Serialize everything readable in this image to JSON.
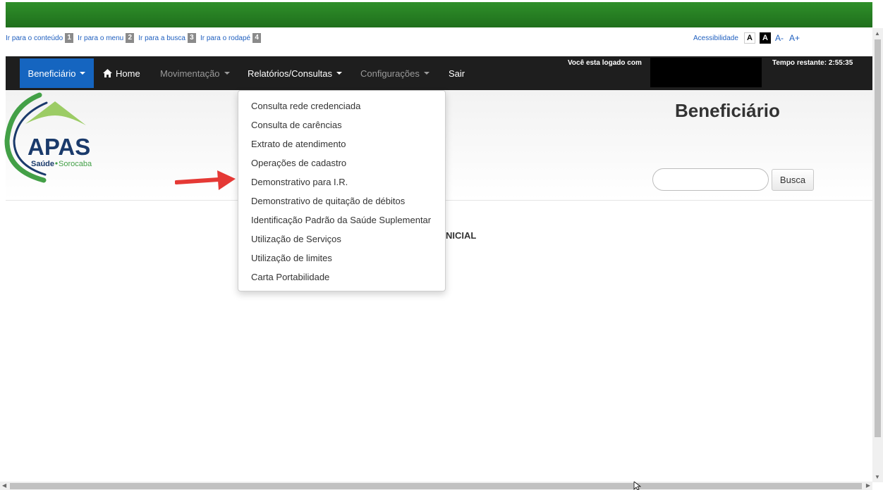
{
  "skip_links": [
    {
      "label": "Ir para o conteúdo",
      "num": "1"
    },
    {
      "label": "Ir para o menu",
      "num": "2"
    },
    {
      "label": "Ir para a busca",
      "num": "3"
    },
    {
      "label": "Ir para o rodapé",
      "num": "4"
    }
  ],
  "accessibility": {
    "label": "Acessibilidade",
    "contrast_light": "A",
    "contrast_dark": "A",
    "font_decrease": "A-",
    "font_increase": "A+"
  },
  "nav": {
    "beneficiario": "Beneficiário",
    "home": "Home",
    "movimentacao": "Movimentação",
    "relatorios": "Relatórios/Consultas",
    "configuracoes": "Configurações",
    "sair": "Sair",
    "logged_in": "Você esta logado com",
    "time_left": "Tempo restante: 2:55:35"
  },
  "header": {
    "logo_text": "APAS",
    "logo_sub_left": "Saúde",
    "logo_sub_right": "Sorocaba",
    "title": "Beneficiário",
    "search_placeholder": "",
    "search_button": "Busca"
  },
  "main": {
    "inicial": "NICIAL"
  },
  "dropdown": {
    "items": [
      "Consulta rede credenciada",
      "Consulta de carências",
      "Extrato de atendimento",
      "Operações de cadastro",
      "Demonstrativo para I.R.",
      "Demonstrativo de quitação de débitos",
      "Identificação Padrão da Saúde Suplementar",
      "Utilização de Serviços",
      "Utilização de limites",
      "Carta Portabilidade"
    ]
  },
  "colors": {
    "banner_green": "#2f8f2a",
    "nav_bg": "#1e1e1e",
    "nav_active": "#1565c0",
    "logo_green": "#43a047",
    "logo_navy": "#1a3a6b",
    "arrow_red": "#e53935"
  }
}
